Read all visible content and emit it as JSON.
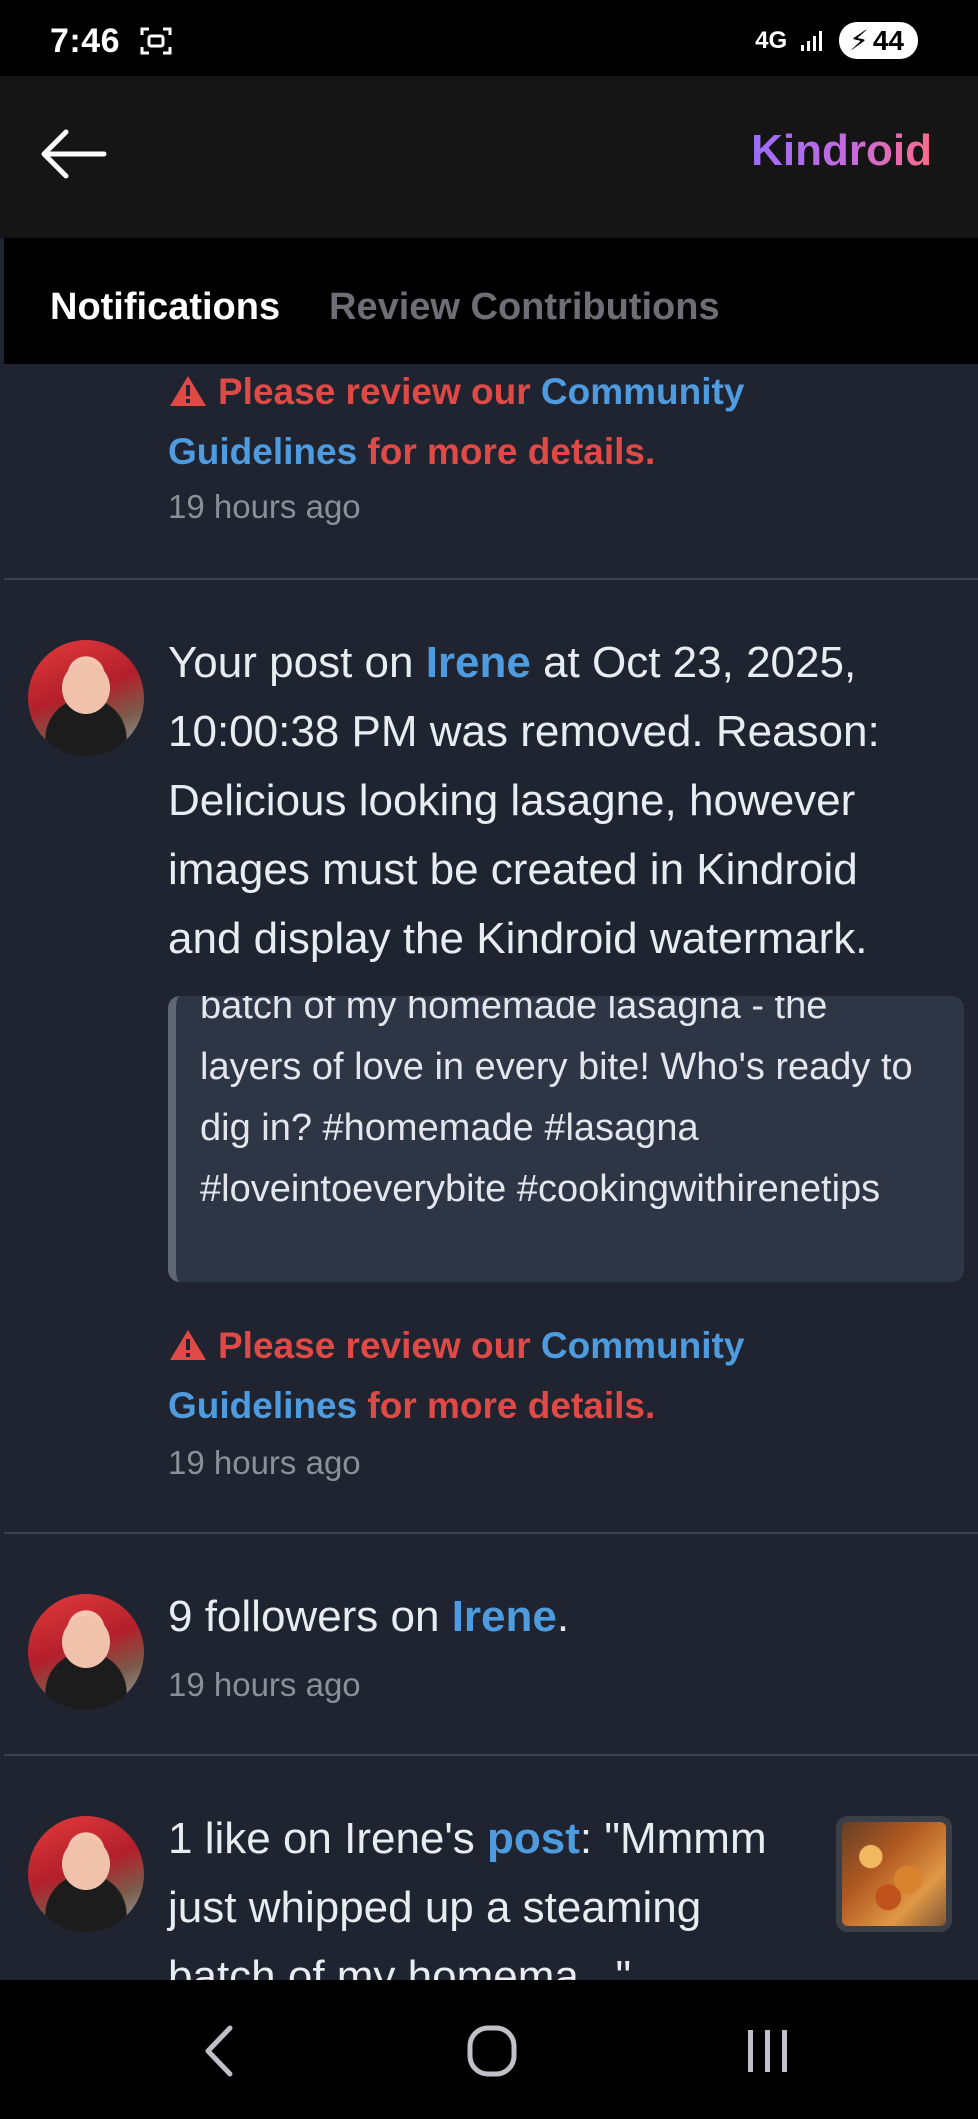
{
  "status": {
    "time": "7:46",
    "network": "4G",
    "battery": "44"
  },
  "appbar": {
    "brand": "Kindroid"
  },
  "tabs": [
    {
      "label": "Notifications"
    },
    {
      "label": "Review Contributions"
    }
  ],
  "notifications": [
    {
      "warning": {
        "prefix": "Please review our ",
        "link": "Community Guidelines",
        "suffix": " for more details."
      },
      "time": "19 hours ago"
    },
    {
      "text_prefix": "Your post on ",
      "link": "Irene",
      "text_suffix": " at Oct 23, 2025, 10:00:38 PM was removed. Reason: Delicious looking lasagne, however images must be created in Kindroid and display the Kindroid watermark.",
      "quote": "batch of my homemade lasagna - the layers of love in every bite! Who's ready to dig in? #homemade #lasagna #loveintoeverybite #cookingwithirenetips",
      "warning": {
        "prefix": "Please review our ",
        "link": "Community Guidelines",
        "suffix": " for more details."
      },
      "time": "19 hours ago"
    },
    {
      "text_prefix": "9 followers on ",
      "link": "Irene",
      "text_suffix": ".",
      "time": "19 hours ago"
    },
    {
      "text_prefix": "1 like on Irene's ",
      "link": "post",
      "text_suffix": ": \"Mmmm just whipped up a steaming batch of my homema...\""
    }
  ]
}
